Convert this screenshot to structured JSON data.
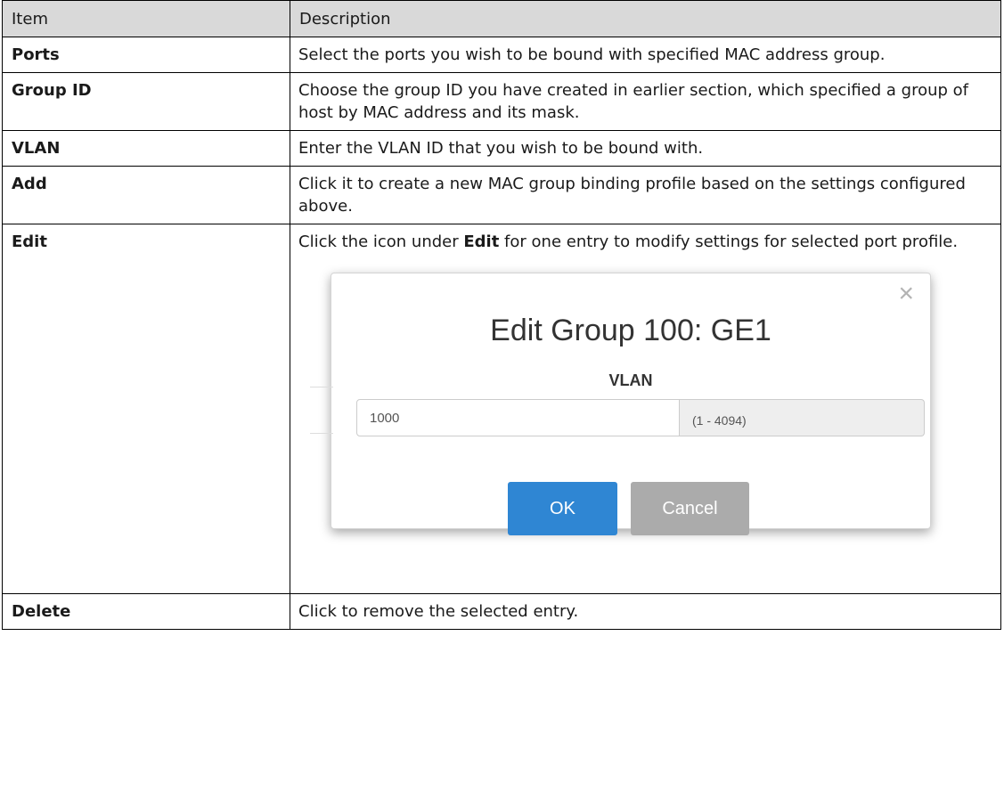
{
  "table": {
    "headers": {
      "item": "Item",
      "description": "Description"
    },
    "rows": {
      "ports": {
        "item": "Ports",
        "description": "Select the ports you wish to be bound with specified MAC address group."
      },
      "group_id": {
        "item": "Group ID",
        "description": "Choose the group ID you have created in earlier section, which specified a group of host by MAC address and its mask."
      },
      "vlan": {
        "item": "VLAN",
        "description": "Enter the VLAN ID that you wish to be bound with."
      },
      "add": {
        "item": "Add",
        "description": "Click it to create a new MAC group binding profile based on the settings configured above."
      },
      "edit": {
        "item": "Edit",
        "description_before": "Click the icon under ",
        "description_bold": "Edit",
        "description_after": " for one entry to modify settings for selected port profile."
      },
      "delete": {
        "item": "Delete",
        "description": "Click to remove the selected entry."
      }
    }
  },
  "dialog": {
    "close_icon": "×",
    "title": "Edit Group 100: GE1",
    "field_label": "VLAN",
    "vlan_value": "1000",
    "range_hint": "(1 - 4094)",
    "ok_label": "OK",
    "cancel_label": "Cancel",
    "colors": {
      "ok": "#2f86d3",
      "cancel": "#ababab",
      "header_bg": "#d9d9d9"
    }
  }
}
